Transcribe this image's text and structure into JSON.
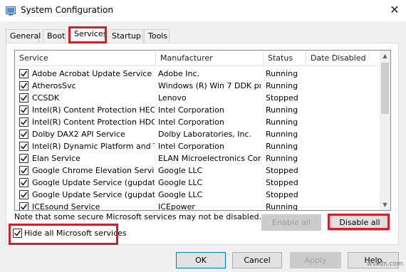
{
  "window": {
    "title": "System Configuration",
    "close_glyph": "✕",
    "app_icon": "msconfig-icon"
  },
  "tabs": [
    {
      "label": "General",
      "active": false
    },
    {
      "label": "Boot",
      "active": false
    },
    {
      "label": "Services",
      "active": true
    },
    {
      "label": "Startup",
      "active": false
    },
    {
      "label": "Tools",
      "active": false
    }
  ],
  "services_table": {
    "columns": [
      "Service",
      "Manufacturer",
      "Status",
      "Date Disabled"
    ],
    "rows": [
      {
        "checked": true,
        "service": "Adobe Acrobat Update Service",
        "manufacturer": "Adobe Inc.",
        "status": "Running",
        "date_disabled": ""
      },
      {
        "checked": true,
        "service": "AtherosSvc",
        "manufacturer": "Windows (R) Win 7 DDK pr...",
        "status": "Running",
        "date_disabled": ""
      },
      {
        "checked": true,
        "service": "CCSDK",
        "manufacturer": "Lenovo",
        "status": "Stopped",
        "date_disabled": ""
      },
      {
        "checked": true,
        "service": "Intel(R) Content Protection HEC...",
        "manufacturer": "Intel Corporation",
        "status": "Running",
        "date_disabled": ""
      },
      {
        "checked": true,
        "service": "Intel(R) Content Protection HDC...",
        "manufacturer": "Intel Corporation",
        "status": "Running",
        "date_disabled": ""
      },
      {
        "checked": true,
        "service": "Dolby DAX2 API Service",
        "manufacturer": "Dolby Laboratories, Inc.",
        "status": "Running",
        "date_disabled": ""
      },
      {
        "checked": true,
        "service": "Intel(R) Dynamic Platform and T...",
        "manufacturer": "Intel Corporation",
        "status": "Running",
        "date_disabled": ""
      },
      {
        "checked": true,
        "service": "Elan Service",
        "manufacturer": "ELAN Microelectronics Corp.",
        "status": "Running",
        "date_disabled": ""
      },
      {
        "checked": true,
        "service": "Google Chrome Elevation Service",
        "manufacturer": "Google LLC",
        "status": "Stopped",
        "date_disabled": ""
      },
      {
        "checked": true,
        "service": "Google Update Service (gupdate)",
        "manufacturer": "Google LLC",
        "status": "Stopped",
        "date_disabled": ""
      },
      {
        "checked": true,
        "service": "Google Update Service (gupdatem)",
        "manufacturer": "Google LLC",
        "status": "Stopped",
        "date_disabled": ""
      },
      {
        "checked": true,
        "service": "ICEsound Service",
        "manufacturer": "ICEpower",
        "status": "Running",
        "date_disabled": ""
      }
    ]
  },
  "note": "Note that some secure Microsoft services may not be disabled.",
  "buttons": {
    "enable_all": "Enable all",
    "disable_all": "Disable all",
    "ok": "OK",
    "cancel": "Cancel",
    "apply": "Apply",
    "help": "Help"
  },
  "hide_ms_services": {
    "label": "Hide all Microsoft services",
    "checked": true
  },
  "watermark": "wsxdn.com",
  "colors": {
    "highlight_red": "#d0202b",
    "default_button_border": "#0078d7"
  }
}
